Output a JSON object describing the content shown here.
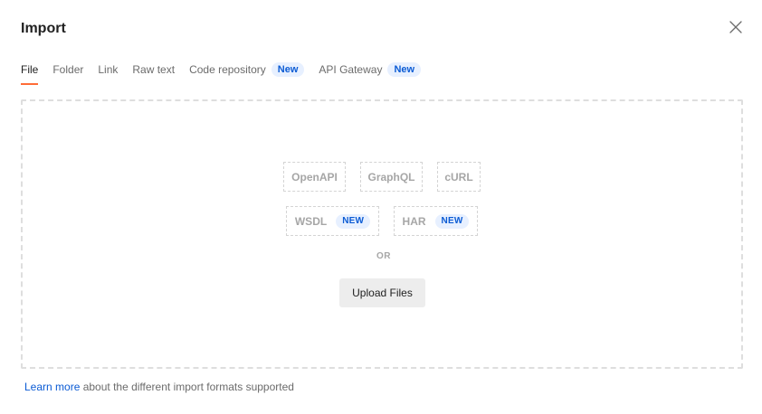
{
  "dialog": {
    "title": "Import"
  },
  "tabs": [
    {
      "label": "File",
      "badge": ""
    },
    {
      "label": "Folder",
      "badge": ""
    },
    {
      "label": "Link",
      "badge": ""
    },
    {
      "label": "Raw text",
      "badge": ""
    },
    {
      "label": "Code repository",
      "badge": "New"
    },
    {
      "label": "API Gateway",
      "badge": "New"
    }
  ],
  "formats": {
    "openapi": "OpenAPI",
    "graphql": "GraphQL",
    "curl": "cURL",
    "wsdl": {
      "label": "WSDL",
      "badge": "NEW"
    },
    "har": {
      "label": "HAR",
      "badge": "NEW"
    }
  },
  "dropzone": {
    "or_text": "OR",
    "upload_label": "Upload Files"
  },
  "footer": {
    "link_text": "Learn more",
    "rest_text": " about the different import formats supported"
  },
  "colors": {
    "accent": "#ff6c37",
    "link": "#0b5bd4",
    "badge_bg": "#e7f0ff"
  },
  "icons": {
    "close": "close-icon"
  }
}
